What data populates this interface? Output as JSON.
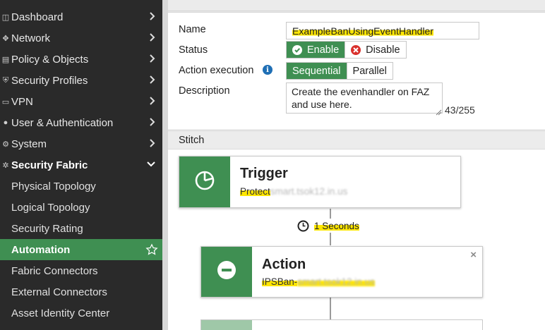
{
  "sidebar": {
    "items": [
      {
        "icon": "dashboard-icon",
        "label": "Dashboard"
      },
      {
        "icon": "network-icon",
        "label": "Network"
      },
      {
        "icon": "policy-icon",
        "label": "Policy & Objects"
      },
      {
        "icon": "security-profiles-icon",
        "label": "Security Profiles"
      },
      {
        "icon": "vpn-icon",
        "label": "VPN"
      },
      {
        "icon": "user-icon",
        "label": "User & Authentication"
      },
      {
        "icon": "gear-icon",
        "label": "System"
      },
      {
        "icon": "security-fabric-icon",
        "label": "Security Fabric"
      }
    ],
    "subitems": [
      {
        "label": "Physical Topology"
      },
      {
        "label": "Logical Topology"
      },
      {
        "label": "Security Rating"
      },
      {
        "label": "Automation"
      },
      {
        "label": "Fabric Connectors"
      },
      {
        "label": "External Connectors"
      },
      {
        "label": "Asset Identity Center"
      }
    ],
    "active_subitem": "Automation"
  },
  "form": {
    "name_label": "Name",
    "name_value": "ExampleBanUsingEventHandler",
    "status_label": "Status",
    "status_enable": "Enable",
    "status_disable": "Disable",
    "status_selected": "Enable",
    "action_execution_label": "Action execution",
    "exec_sequential": "Sequential",
    "exec_parallel": "Parallel",
    "exec_selected": "Sequential",
    "description_label": "Description",
    "description_value": "Create the evenhandler on FAZ and use here.",
    "char_counter": "43/255"
  },
  "stitch": {
    "header": "Stitch",
    "trigger": {
      "title": "Trigger",
      "sub_visible": "Protect",
      "sub_obscured": "smart.tsok12.in.us"
    },
    "delay": {
      "text": "1 Seconds"
    },
    "action": {
      "title": "Action",
      "sub_visible": "IPSBan-",
      "sub_obscured": "smart.tsok12.in.us",
      "close": "×"
    }
  },
  "colors": {
    "accent": "#3f8f52",
    "sidebar_bg": "#2a2a2a",
    "highlight": "#ffe600",
    "disable_red": "#d9302c"
  }
}
